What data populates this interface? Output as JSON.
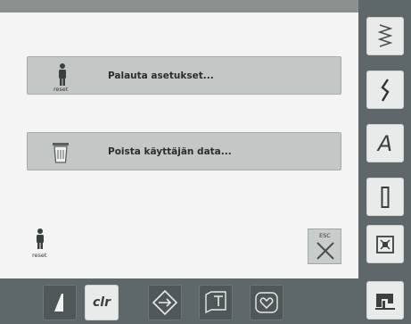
{
  "menu": {
    "items": [
      {
        "label": "Palauta asetukset...",
        "icon": "reset-person-icon",
        "icon_caption": "reset"
      },
      {
        "label": "Poista käyttäjän data...",
        "icon": "trash-bin-icon"
      }
    ]
  },
  "footer_reset": {
    "caption": "reset",
    "icon": "reset-person-icon"
  },
  "esc": {
    "label": "ESC",
    "icon": "close-x-icon"
  },
  "sidebar": {
    "items": [
      {
        "name": "zigzag-stitch",
        "icon": "zigzag-stitch-icon"
      },
      {
        "name": "decorative-stitch",
        "icon": "decorative-stitch-icon"
      },
      {
        "name": "alphabet",
        "icon": "alphabet-icon",
        "glyph": "A"
      },
      {
        "name": "buttonhole",
        "icon": "buttonhole-icon"
      },
      {
        "name": "quilt",
        "icon": "quilt-stitch-icon"
      },
      {
        "name": "sewing-machine",
        "icon": "sewing-machine-icon"
      }
    ]
  },
  "bottombar": {
    "items": [
      {
        "name": "needle-stop",
        "icon": "needle-stop-icon"
      },
      {
        "name": "clear",
        "label": "clr"
      },
      {
        "name": "setup",
        "icon": "setup-diamond-icon"
      },
      {
        "name": "tutorial",
        "icon": "tutorial-book-icon"
      },
      {
        "name": "favorites",
        "icon": "heart-icon"
      }
    ]
  },
  "colors": {
    "panel": "#f4f4f4",
    "button": "#c3c7c6",
    "frame": "#5e6769",
    "side_button": "#e9eaea"
  }
}
